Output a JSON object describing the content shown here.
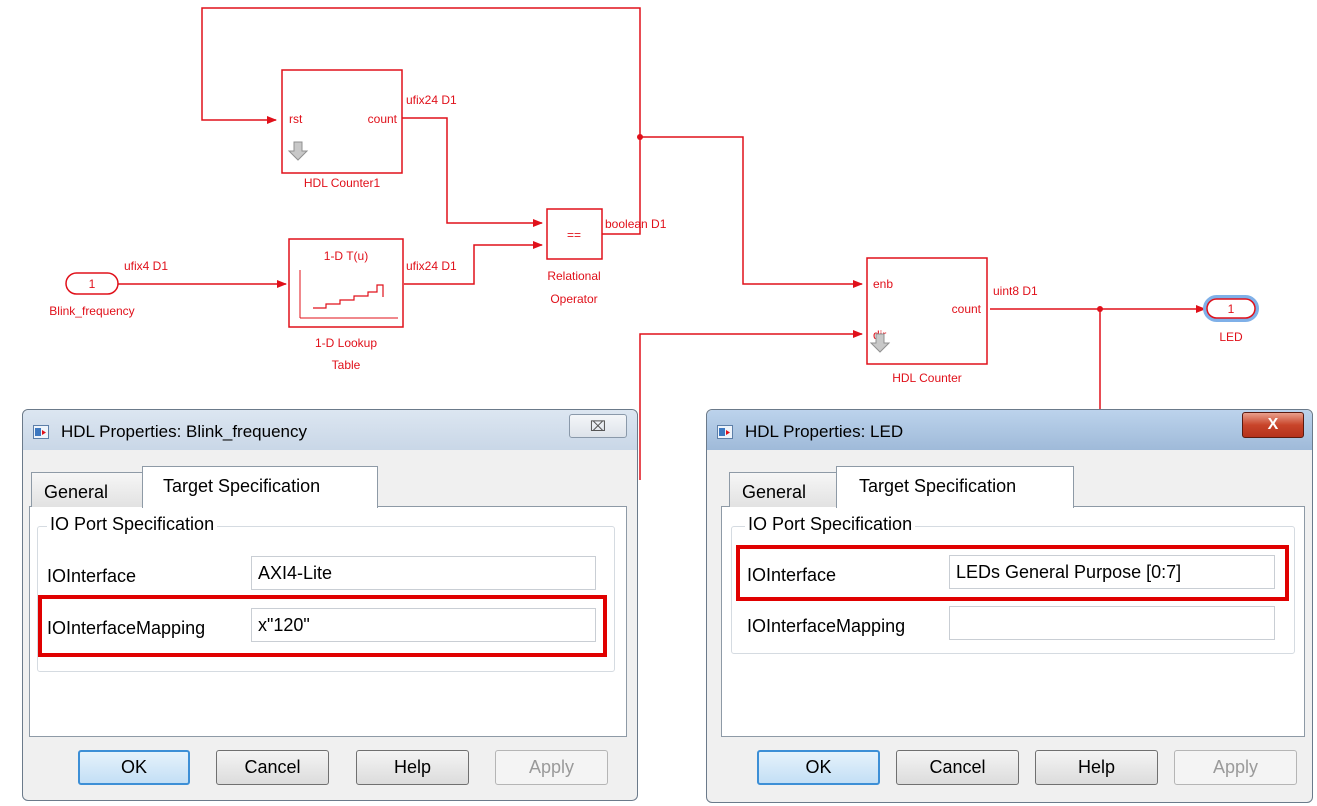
{
  "diagram": {
    "blocks": {
      "hdl_counter1": {
        "port_rst": "rst",
        "port_count": "count",
        "name": "HDL Counter1"
      },
      "lookup_table": {
        "label": "1-D T(u)",
        "name_line1": "1-D Lookup",
        "name_line2": "Table"
      },
      "relational_operator": {
        "symbol": "==",
        "name_line1": "Relational",
        "name_line2": "Operator"
      },
      "hdl_counter": {
        "port_enb": "enb",
        "port_dir": "dir",
        "port_count": "count",
        "name": "HDL Counter"
      },
      "inport": {
        "number": "1",
        "name": "Blink_frequency"
      },
      "outport": {
        "number": "1",
        "name": "LED"
      }
    },
    "signals": {
      "counter1_out": "ufix24 D1",
      "inport_out": "ufix4 D1",
      "lut_out": "ufix24 D1",
      "relop_out": "boolean D1",
      "counter_out": "uint8 D1"
    },
    "colors": {
      "block": "#e0101a",
      "highlight": "#e00000"
    }
  },
  "dialog1": {
    "title": "HDL Properties: Blink_frequency",
    "close_label": "⌧",
    "tabs": [
      "General",
      "Target Specification"
    ],
    "active_tab": "Target Specification",
    "group_title": "IO Port Specification",
    "rows": [
      {
        "label": "IOInterface",
        "value": "AXI4-Lite"
      },
      {
        "label": "IOInterfaceMapping",
        "value": "x\"120\""
      }
    ],
    "buttons": {
      "ok": "OK",
      "cancel": "Cancel",
      "help": "Help",
      "apply": "Apply"
    }
  },
  "dialog2": {
    "title": "HDL Properties: LED",
    "close_label": "X",
    "tabs": [
      "General",
      "Target Specification"
    ],
    "active_tab": "Target Specification",
    "group_title": "IO Port Specification",
    "rows": [
      {
        "label": "IOInterface",
        "value": "LEDs General Purpose [0:7]"
      },
      {
        "label": "IOInterfaceMapping",
        "value": ""
      }
    ],
    "buttons": {
      "ok": "OK",
      "cancel": "Cancel",
      "help": "Help",
      "apply": "Apply"
    }
  }
}
